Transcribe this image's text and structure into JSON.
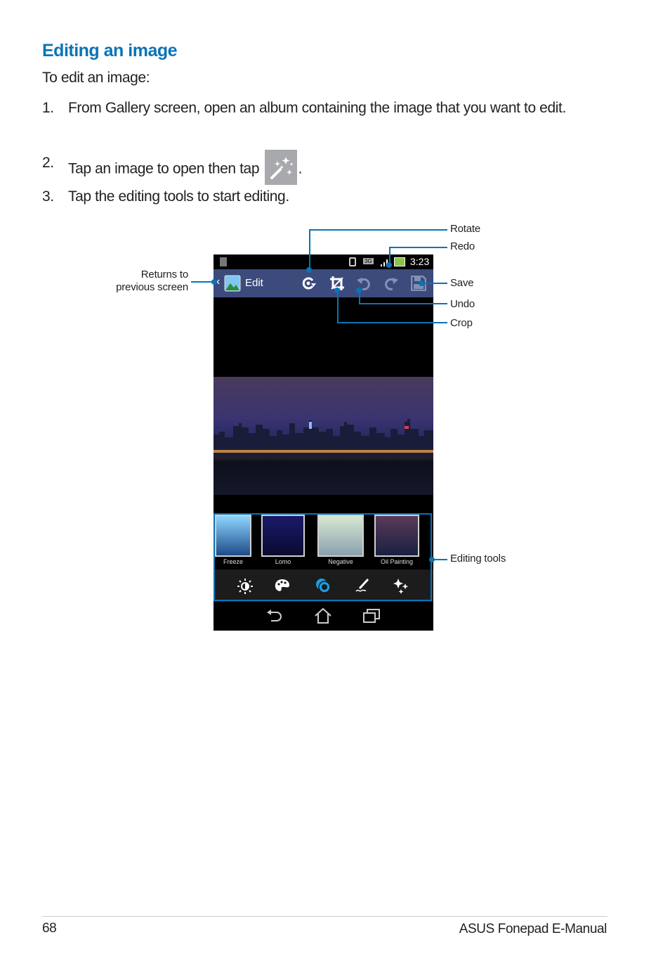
{
  "heading": "Editing an image",
  "intro": "To edit an image:",
  "steps": [
    {
      "num": "1.",
      "text": "From Gallery screen, open an album containing the image that you want to edit."
    },
    {
      "num": "2.",
      "text_before": "Tap an image to open then tap",
      "text_after": ".",
      "icon": "magic-wand-icon"
    },
    {
      "num": "3.",
      "text": "Tap the editing tools to start editing."
    }
  ],
  "callouts": {
    "rotate": "Rotate",
    "redo": "Redo",
    "save": "Save",
    "undo": "Undo",
    "crop": "Crop",
    "returns_line1": "Returns to",
    "returns_line2": "previous screen",
    "editing_tools": "Editing tools"
  },
  "phone": {
    "status": {
      "network": "3G",
      "time": "3:23"
    },
    "actionbar": {
      "title": "Edit"
    },
    "filters": [
      {
        "label": "Freeze",
        "colors": [
          "#8fd4ff",
          "#1d4c8a"
        ]
      },
      {
        "label": "Lomo",
        "colors": [
          "#1a1a6a",
          "#0a0a30"
        ]
      },
      {
        "label": "Negative",
        "colors": [
          "#d8e8d0",
          "#8aa0b0"
        ]
      },
      {
        "label": "Oil Painting",
        "colors": [
          "#5a3a5a",
          "#1a2040"
        ]
      }
    ],
    "tools": [
      "brightness-icon",
      "palette-icon",
      "effects-icon",
      "draw-icon",
      "sparkle-icon"
    ],
    "nav": [
      "back-icon",
      "home-icon",
      "recent-apps-icon"
    ]
  },
  "footer": {
    "page": "68",
    "manual": "ASUS Fonepad E-Manual"
  },
  "colors": {
    "accent": "#0a73b7",
    "actionbar": "#3c4a7c"
  }
}
